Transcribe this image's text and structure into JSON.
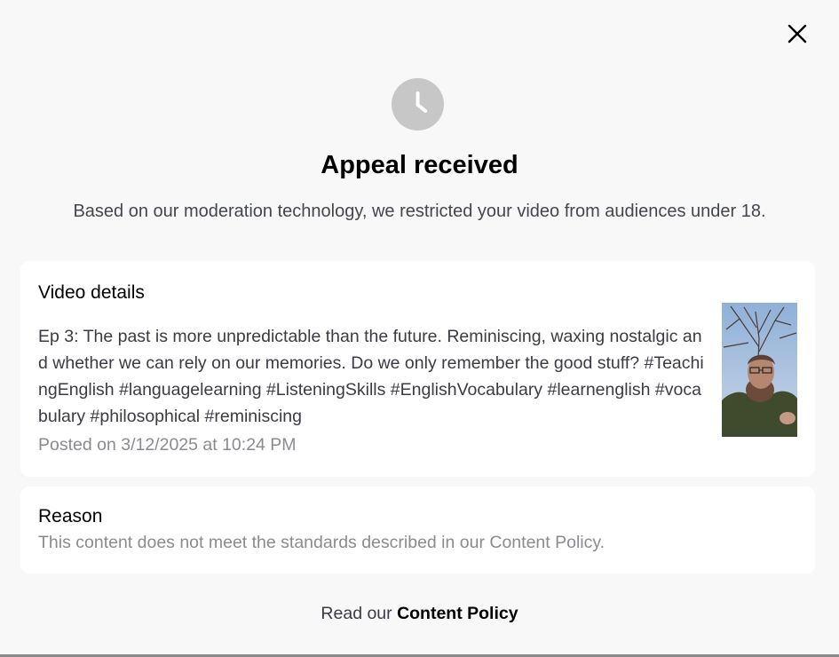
{
  "icons": {
    "close": "close-icon",
    "status": "clock-icon",
    "thumbnail": "video-thumbnail-image"
  },
  "colors": {
    "background": "#f8f8f8",
    "card": "#ffffff",
    "status_icon": "#c7c7c7"
  },
  "header": {
    "title": "Appeal received",
    "subtitle": "Based on our moderation technology, we restricted your video from audiences under 18."
  },
  "video_details": {
    "heading": "Video details",
    "description": "Ep 3: The past is more unpredictable than the future. Reminiscing, waxing nostalgic and whether we can rely on our memories. Do we only remember the good stuff? #TeachingEnglish #languagelearning #ListeningSkills #EnglishVocabulary #learnenglish #vocabulary #philosophical #reminiscing",
    "posted": "Posted on 3/12/2025 at 10:24 PM"
  },
  "reason": {
    "heading": "Reason",
    "text": "This content does not meet the standards described in our Content Policy."
  },
  "footer": {
    "prefix": "Read our ",
    "link_label": "Content Policy"
  }
}
